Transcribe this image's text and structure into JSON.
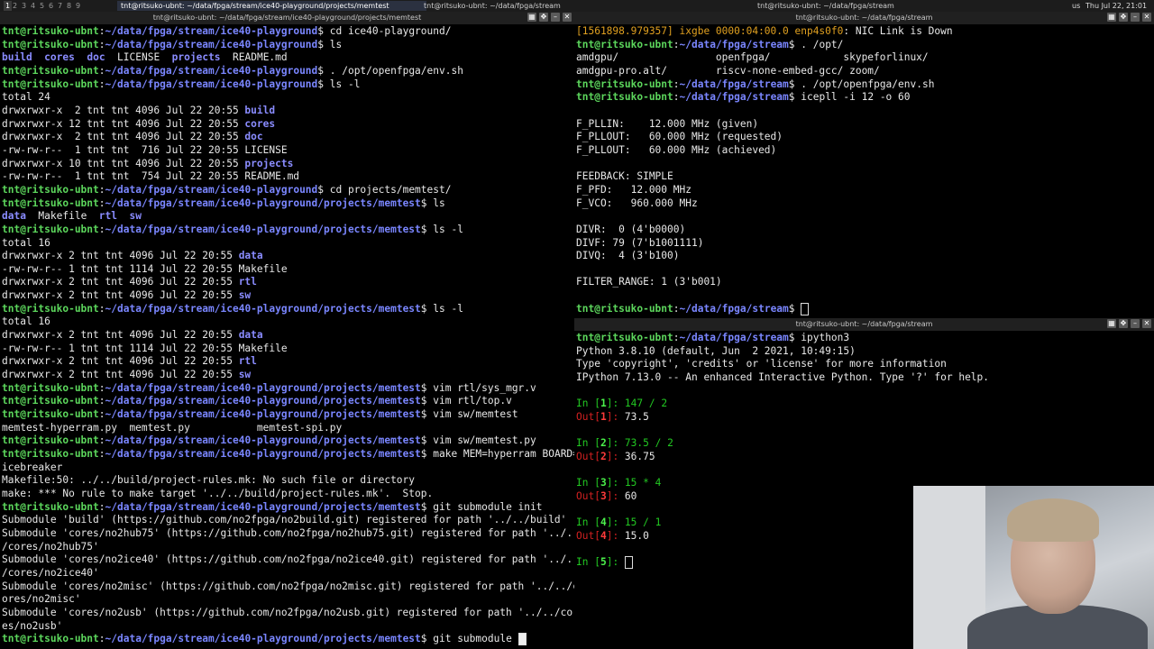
{
  "topbar": {
    "workspaces": [
      "1",
      "2",
      "3",
      "4",
      "5",
      "6",
      "7",
      "8",
      "9"
    ],
    "active_workspace": "1",
    "windows": [
      "tnt@ritsuko-ubnt: ~/data/fpga/stream/ice40-playground/projects/memtest",
      "tnt@ritsuko-ubnt: ~/data/fpga/stream",
      "tnt@ritsuko-ubnt: ~/data/fpga/stream"
    ],
    "keyboard_layout": "us",
    "clock": "Thu Jul 22, 21:01"
  },
  "panes": {
    "left": {
      "title": "tnt@ritsuko-ubnt: ~/data/fpga/stream/ice40-playground/projects/memtest",
      "lines": [
        [
          {
            "t": "tnt@ritsuko-ubnt",
            "c": "u"
          },
          {
            "t": ":"
          },
          {
            "t": "~/data/fpga/stream/ice40-playground",
            "c": "p"
          },
          {
            "t": "$ cd ice40-playground/"
          }
        ],
        [
          {
            "t": "tnt@ritsuko-ubnt",
            "c": "u"
          },
          {
            "t": ":"
          },
          {
            "t": "~/data/fpga/stream/ice40-playground",
            "c": "p"
          },
          {
            "t": "$ ls"
          }
        ],
        [
          {
            "t": "build",
            "c": "dir"
          },
          {
            "t": "  "
          },
          {
            "t": "cores",
            "c": "dir"
          },
          {
            "t": "  "
          },
          {
            "t": "doc",
            "c": "dir"
          },
          {
            "t": "  LICENSE  "
          },
          {
            "t": "projects",
            "c": "dir"
          },
          {
            "t": "  README.md"
          }
        ],
        [
          {
            "t": "tnt@ritsuko-ubnt",
            "c": "u"
          },
          {
            "t": ":"
          },
          {
            "t": "~/data/fpga/stream/ice40-playground",
            "c": "p"
          },
          {
            "t": "$ . /opt/openfpga/env.sh"
          }
        ],
        [
          {
            "t": "tnt@ritsuko-ubnt",
            "c": "u"
          },
          {
            "t": ":"
          },
          {
            "t": "~/data/fpga/stream/ice40-playground",
            "c": "p"
          },
          {
            "t": "$ ls -l"
          }
        ],
        [
          {
            "t": "total 24"
          }
        ],
        [
          {
            "t": "drwxrwxr-x  2 tnt tnt 4096 Jul 22 20:55 "
          },
          {
            "t": "build",
            "c": "dir"
          }
        ],
        [
          {
            "t": "drwxrwxr-x 12 tnt tnt 4096 Jul 22 20:55 "
          },
          {
            "t": "cores",
            "c": "dir"
          }
        ],
        [
          {
            "t": "drwxrwxr-x  2 tnt tnt 4096 Jul 22 20:55 "
          },
          {
            "t": "doc",
            "c": "dir"
          }
        ],
        [
          {
            "t": "-rw-rw-r--  1 tnt tnt  716 Jul 22 20:55 LICENSE"
          }
        ],
        [
          {
            "t": "drwxrwxr-x 10 tnt tnt 4096 Jul 22 20:55 "
          },
          {
            "t": "projects",
            "c": "dir"
          }
        ],
        [
          {
            "t": "-rw-rw-r--  1 tnt tnt  754 Jul 22 20:55 README.md"
          }
        ],
        [
          {
            "t": "tnt@ritsuko-ubnt",
            "c": "u"
          },
          {
            "t": ":"
          },
          {
            "t": "~/data/fpga/stream/ice40-playground",
            "c": "p"
          },
          {
            "t": "$ cd projects/memtest/"
          }
        ],
        [
          {
            "t": "tnt@ritsuko-ubnt",
            "c": "u"
          },
          {
            "t": ":"
          },
          {
            "t": "~/data/fpga/stream/ice40-playground/projects/memtest",
            "c": "p"
          },
          {
            "t": "$ ls"
          }
        ],
        [
          {
            "t": "data",
            "c": "dir"
          },
          {
            "t": "  Makefile  "
          },
          {
            "t": "rtl",
            "c": "dir"
          },
          {
            "t": "  "
          },
          {
            "t": "sw",
            "c": "dir"
          }
        ],
        [
          {
            "t": "tnt@ritsuko-ubnt",
            "c": "u"
          },
          {
            "t": ":"
          },
          {
            "t": "~/data/fpga/stream/ice40-playground/projects/memtest",
            "c": "p"
          },
          {
            "t": "$ ls -l"
          }
        ],
        [
          {
            "t": "total 16"
          }
        ],
        [
          {
            "t": "drwxrwxr-x 2 tnt tnt 4096 Jul 22 20:55 "
          },
          {
            "t": "data",
            "c": "dir"
          }
        ],
        [
          {
            "t": "-rw-rw-r-- 1 tnt tnt 1114 Jul 22 20:55 Makefile"
          }
        ],
        [
          {
            "t": "drwxrwxr-x 2 tnt tnt 4096 Jul 22 20:55 "
          },
          {
            "t": "rtl",
            "c": "dir"
          }
        ],
        [
          {
            "t": "drwxrwxr-x 2 tnt tnt 4096 Jul 22 20:55 "
          },
          {
            "t": "sw",
            "c": "dir"
          }
        ],
        [
          {
            "t": "tnt@ritsuko-ubnt",
            "c": "u"
          },
          {
            "t": ":"
          },
          {
            "t": "~/data/fpga/stream/ice40-playground/projects/memtest",
            "c": "p"
          },
          {
            "t": "$ ls -l"
          }
        ],
        [
          {
            "t": "total 16"
          }
        ],
        [
          {
            "t": "drwxrwxr-x 2 tnt tnt 4096 Jul 22 20:55 "
          },
          {
            "t": "data",
            "c": "dir"
          }
        ],
        [
          {
            "t": "-rw-rw-r-- 1 tnt tnt 1114 Jul 22 20:55 Makefile"
          }
        ],
        [
          {
            "t": "drwxrwxr-x 2 tnt tnt 4096 Jul 22 20:55 "
          },
          {
            "t": "rtl",
            "c": "dir"
          }
        ],
        [
          {
            "t": "drwxrwxr-x 2 tnt tnt 4096 Jul 22 20:55 "
          },
          {
            "t": "sw",
            "c": "dir"
          }
        ],
        [
          {
            "t": "tnt@ritsuko-ubnt",
            "c": "u"
          },
          {
            "t": ":"
          },
          {
            "t": "~/data/fpga/stream/ice40-playground/projects/memtest",
            "c": "p"
          },
          {
            "t": "$ vim rtl/sys_mgr.v"
          }
        ],
        [
          {
            "t": "tnt@ritsuko-ubnt",
            "c": "u"
          },
          {
            "t": ":"
          },
          {
            "t": "~/data/fpga/stream/ice40-playground/projects/memtest",
            "c": "p"
          },
          {
            "t": "$ vim rtl/top.v"
          }
        ],
        [
          {
            "t": "tnt@ritsuko-ubnt",
            "c": "u"
          },
          {
            "t": ":"
          },
          {
            "t": "~/data/fpga/stream/ice40-playground/projects/memtest",
            "c": "p"
          },
          {
            "t": "$ vim sw/memtest"
          }
        ],
        [
          {
            "t": "memtest-hyperram.py  memtest.py           memtest-spi.py"
          }
        ],
        [
          {
            "t": "tnt@ritsuko-ubnt",
            "c": "u"
          },
          {
            "t": ":"
          },
          {
            "t": "~/data/fpga/stream/ice40-playground/projects/memtest",
            "c": "p"
          },
          {
            "t": "$ vim sw/memtest.py"
          }
        ],
        [
          {
            "t": "tnt@ritsuko-ubnt",
            "c": "u"
          },
          {
            "t": ":"
          },
          {
            "t": "~/data/fpga/stream/ice40-playground/projects/memtest",
            "c": "p"
          },
          {
            "t": "$ make MEM=hyperram BOARD="
          }
        ],
        [
          {
            "t": "icebreaker"
          }
        ],
        [
          {
            "t": "Makefile:50: ../../build/project-rules.mk: No such file or directory"
          }
        ],
        [
          {
            "t": "make: *** No rule to make target '../../build/project-rules.mk'.  Stop."
          }
        ],
        [
          {
            "t": "tnt@ritsuko-ubnt",
            "c": "u"
          },
          {
            "t": ":"
          },
          {
            "t": "~/data/fpga/stream/ice40-playground/projects/memtest",
            "c": "p"
          },
          {
            "t": "$ git submodule init"
          }
        ],
        [
          {
            "t": "Submodule 'build' (https://github.com/no2fpga/no2build.git) registered for path '../../build'"
          }
        ],
        [
          {
            "t": "Submodule 'cores/no2hub75' (https://github.com/no2fpga/no2hub75.git) registered for path '../.."
          }
        ],
        [
          {
            "t": "/cores/no2hub75'"
          }
        ],
        [
          {
            "t": "Submodule 'cores/no2ice40' (https://github.com/no2fpga/no2ice40.git) registered for path '../.."
          }
        ],
        [
          {
            "t": "/cores/no2ice40'"
          }
        ],
        [
          {
            "t": "Submodule 'cores/no2misc' (https://github.com/no2fpga/no2misc.git) registered for path '../../c"
          }
        ],
        [
          {
            "t": "ores/no2misc'"
          }
        ],
        [
          {
            "t": "Submodule 'cores/no2usb' (https://github.com/no2fpga/no2usb.git) registered for path '../../cor"
          }
        ],
        [
          {
            "t": "es/no2usb'"
          }
        ],
        [
          {
            "t": "tnt@ritsuko-ubnt",
            "c": "u"
          },
          {
            "t": ":"
          },
          {
            "t": "~/data/fpga/stream/ice40-playground/projects/memtest",
            "c": "p"
          },
          {
            "t": "$ git submodule "
          },
          {
            "cursor": "filled"
          }
        ]
      ]
    },
    "top_right": {
      "title": "tnt@ritsuko-ubnt: ~/data/fpga/stream",
      "lines": [
        [
          {
            "t": "[1561898.979357] ",
            "c": "kern"
          },
          {
            "t": "ixgbe 0000:04:00.0 enp4s0f0",
            "c": "kern"
          },
          {
            "t": ": NIC Link is Down"
          }
        ],
        [
          {
            "t": "tnt@ritsuko-ubnt",
            "c": "u"
          },
          {
            "t": ":"
          },
          {
            "t": "~/data/fpga/stream",
            "c": "p"
          },
          {
            "t": "$ . /opt/"
          }
        ],
        [
          {
            "t": "amdgpu/                openfpga/            skypeforlinux/"
          }
        ],
        [
          {
            "t": "amdgpu-pro.alt/        riscv-none-embed-gcc/ zoom/"
          }
        ],
        [
          {
            "t": "tnt@ritsuko-ubnt",
            "c": "u"
          },
          {
            "t": ":"
          },
          {
            "t": "~/data/fpga/stream",
            "c": "p"
          },
          {
            "t": "$ . /opt/openfpga/env.sh"
          }
        ],
        [
          {
            "t": "tnt@ritsuko-ubnt",
            "c": "u"
          },
          {
            "t": ":"
          },
          {
            "t": "~/data/fpga/stream",
            "c": "p"
          },
          {
            "t": "$ icepll -i 12 -o 60"
          }
        ],
        [
          {
            "t": ""
          }
        ],
        [
          {
            "t": "F_PLLIN:    12.000 MHz (given)"
          }
        ],
        [
          {
            "t": "F_PLLOUT:   60.000 MHz (requested)"
          }
        ],
        [
          {
            "t": "F_PLLOUT:   60.000 MHz (achieved)"
          }
        ],
        [
          {
            "t": ""
          }
        ],
        [
          {
            "t": "FEEDBACK: SIMPLE"
          }
        ],
        [
          {
            "t": "F_PFD:   12.000 MHz"
          }
        ],
        [
          {
            "t": "F_VCO:   960.000 MHz"
          }
        ],
        [
          {
            "t": ""
          }
        ],
        [
          {
            "t": "DIVR:  0 (4'b0000)"
          }
        ],
        [
          {
            "t": "DIVF: 79 (7'b1001111)"
          }
        ],
        [
          {
            "t": "DIVQ:  4 (3'b100)"
          }
        ],
        [
          {
            "t": ""
          }
        ],
        [
          {
            "t": "FILTER_RANGE: 1 (3'b001)"
          }
        ],
        [
          {
            "t": ""
          }
        ],
        [
          {
            "t": "tnt@ritsuko-ubnt",
            "c": "u"
          },
          {
            "t": ":"
          },
          {
            "t": "~/data/fpga/stream",
            "c": "p"
          },
          {
            "t": "$ "
          },
          {
            "cursor": "hollow"
          }
        ]
      ]
    },
    "bottom_right": {
      "title": "tnt@ritsuko-ubnt: ~/data/fpga/stream",
      "lines": [
        [
          {
            "t": "tnt@ritsuko-ubnt",
            "c": "u"
          },
          {
            "t": ":"
          },
          {
            "t": "~/data/fpga/stream",
            "c": "p"
          },
          {
            "t": "$ ipython3"
          }
        ],
        [
          {
            "t": "Python 3.8.10 (default, Jun  2 2021, 10:49:15)"
          }
        ],
        [
          {
            "t": "Type 'copyright', 'credits' or 'license' for more information"
          }
        ],
        [
          {
            "t": "IPython 7.13.0 -- An enhanced Interactive Python. Type '?' for help."
          }
        ],
        [
          {
            "t": ""
          }
        ],
        [
          {
            "t": "In [",
            "c": "inp"
          },
          {
            "t": "1",
            "c": "inpn"
          },
          {
            "t": "]: ",
            "c": "inp"
          },
          {
            "t": "147 / 2",
            "c": "inp"
          }
        ],
        [
          {
            "t": "Out[",
            "c": "out"
          },
          {
            "t": "1",
            "c": "outn"
          },
          {
            "t": "]: ",
            "c": "out"
          },
          {
            "t": "73.5"
          }
        ],
        [
          {
            "t": ""
          }
        ],
        [
          {
            "t": "In [",
            "c": "inp"
          },
          {
            "t": "2",
            "c": "inpn"
          },
          {
            "t": "]: ",
            "c": "inp"
          },
          {
            "t": "73.5 / 2",
            "c": "inp"
          }
        ],
        [
          {
            "t": "Out[",
            "c": "out"
          },
          {
            "t": "2",
            "c": "outn"
          },
          {
            "t": "]: ",
            "c": "out"
          },
          {
            "t": "36.75"
          }
        ],
        [
          {
            "t": ""
          }
        ],
        [
          {
            "t": "In [",
            "c": "inp"
          },
          {
            "t": "3",
            "c": "inpn"
          },
          {
            "t": "]: ",
            "c": "inp"
          },
          {
            "t": "15 * 4",
            "c": "inp"
          }
        ],
        [
          {
            "t": "Out[",
            "c": "out"
          },
          {
            "t": "3",
            "c": "outn"
          },
          {
            "t": "]: ",
            "c": "out"
          },
          {
            "t": "60"
          }
        ],
        [
          {
            "t": ""
          }
        ],
        [
          {
            "t": "In [",
            "c": "inp"
          },
          {
            "t": "4",
            "c": "inpn"
          },
          {
            "t": "]: ",
            "c": "inp"
          },
          {
            "t": "15 / 1",
            "c": "inp"
          }
        ],
        [
          {
            "t": "Out[",
            "c": "out"
          },
          {
            "t": "4",
            "c": "outn"
          },
          {
            "t": "]: ",
            "c": "out"
          },
          {
            "t": "15.0"
          }
        ],
        [
          {
            "t": ""
          }
        ],
        [
          {
            "t": "In [",
            "c": "inp"
          },
          {
            "t": "5",
            "c": "inpn"
          },
          {
            "t": "]: ",
            "c": "inp"
          },
          {
            "cursor": "hollow"
          }
        ]
      ]
    }
  },
  "colors": {
    "user_host": "#5cd65c",
    "path": "#7a86ff",
    "directory": "#8a8cff",
    "ipython_in": "#22c922",
    "ipython_out": "#d02020",
    "kernel_log": "#e0a020"
  },
  "icons": {
    "window_controls": [
      "tile-icon",
      "move-icon",
      "minimize-icon",
      "close-icon"
    ]
  }
}
